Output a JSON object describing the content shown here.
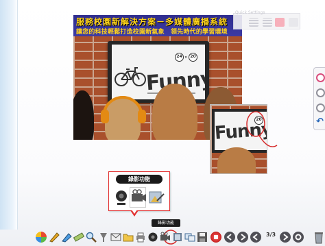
{
  "slide": {
    "title": "服務校園新解決方案－多媒體廣播系統",
    "subtitle": "讓您的科技輕鬆打造校園新氣象　領先時代的學習環境",
    "tv_text": "Funny",
    "badge_left": "24",
    "badge_right": "20",
    "badge_separator": "×"
  },
  "inset": {
    "tv_text": "Funny",
    "badge": "20"
  },
  "callout": {
    "title": "錄影功能"
  },
  "float_toolbar": {
    "title": "Quick Settings"
  },
  "tooltip": {
    "text": "錄影功能"
  },
  "page_counter": "3/3",
  "colors": {
    "brick": "#a9502c",
    "banner": "#2f2d8e",
    "banner_text": "#ffd31a",
    "callout_border": "#e23030"
  },
  "toolbar_icons": [
    "windows-logo-icon",
    "pen-icon",
    "marker-icon",
    "ruler-icon",
    "magnify-icon",
    "spotlight-icon",
    "mail-icon",
    "folder-icon",
    "printer-icon",
    "camera-icon",
    "record-icon",
    "film-icon",
    "screens-icon",
    "save-icon",
    "stop-icon",
    "prev-icon",
    "next-icon",
    "page-prev-icon",
    "page-next-icon",
    "exit-icon"
  ]
}
